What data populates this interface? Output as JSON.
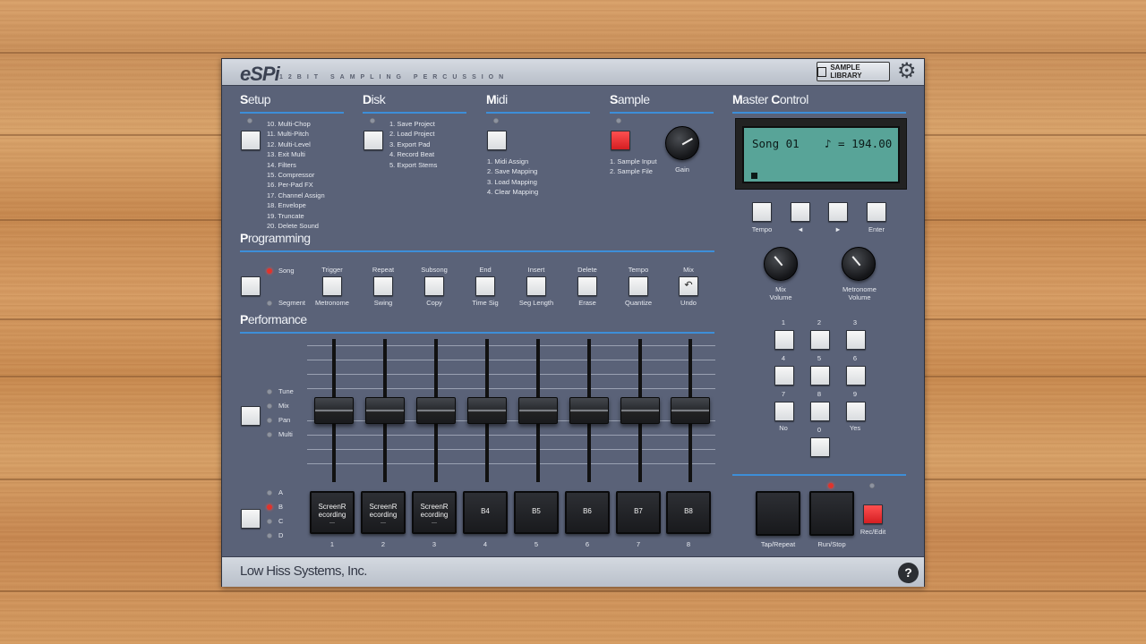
{
  "app": {
    "logo": "eSPi",
    "subtitle": "12BIT SAMPLING PERCUSSION",
    "sample_library": "SAMPLE LIBRARY",
    "footer_brand": "Low Hiss Systems, Inc.",
    "help": "?"
  },
  "setup": {
    "title_first": "S",
    "title_rest": "etup",
    "items": [
      "10. Multi-Chop",
      "11. Multi-Pitch",
      "12. Multi-Level",
      "13. Exit Multi",
      "14. Filters",
      "15. Compressor",
      "16. Per-Pad FX",
      "17. Channel Assign",
      "18. Envelope",
      "19. Truncate",
      "20. Delete Sound"
    ]
  },
  "disk": {
    "title_first": "D",
    "title_rest": "isk",
    "items": [
      "1. Save Project",
      "2. Load Project",
      "3. Export Pad",
      "4. Record Beat",
      "5. Export Stems"
    ]
  },
  "midi": {
    "title_first": "M",
    "title_rest": "idi",
    "items": [
      "1. Midi Assign",
      "2. Save Mapping",
      "3. Load Mapping",
      "4. Clear Mapping"
    ]
  },
  "sample": {
    "title_first": "S",
    "title_rest": "ample",
    "items": [
      "1. Sample Input",
      "2. Sample File"
    ],
    "gain": "Gain"
  },
  "master": {
    "title_first": "M",
    "title_rest": "aster ",
    "title_first2": "C",
    "title_rest2": "ontrol",
    "lcd_line_left": "Song 01",
    "lcd_line_right": "♪ = 194.00",
    "nav": [
      "Tempo",
      "◄",
      "►",
      "Enter"
    ],
    "mix_volume": "Mix\nVolume",
    "metronome_volume": "Metronome\nVolume",
    "keypad": [
      "1",
      "2",
      "3",
      "4",
      "5",
      "6",
      "7",
      "8",
      "9",
      "No",
      "0",
      "Yes"
    ],
    "transport": [
      "Tap/Repeat",
      "Run/Stop",
      "Rec/Edit"
    ]
  },
  "programming": {
    "title_first": "P",
    "title_rest": "rogramming",
    "song": "Song",
    "segment": "Segment",
    "top_labels": [
      "Trigger",
      "Repeat",
      "Subsong",
      "End",
      "Insert",
      "Delete",
      "Tempo",
      "Mix"
    ],
    "bottom_labels": [
      "Metronome",
      "Swing",
      "Copy",
      "Time Sig",
      "Seg Length",
      "Erase",
      "Quantize",
      "Undo"
    ]
  },
  "performance": {
    "title_first": "P",
    "title_rest": "erformance",
    "modes": [
      "Tune",
      "Mix",
      "Pan",
      "Multi"
    ],
    "banks": [
      "A",
      "B",
      "C",
      "D"
    ],
    "pads": [
      {
        "label": "ScreenR\necording",
        "dash": "—",
        "num": "1"
      },
      {
        "label": "ScreenR\necording",
        "dash": "—",
        "num": "2"
      },
      {
        "label": "ScreenR\necording",
        "dash": "—",
        "num": "3"
      },
      {
        "label": "B4",
        "dash": "",
        "num": "4"
      },
      {
        "label": "B5",
        "dash": "",
        "num": "5"
      },
      {
        "label": "B6",
        "dash": "",
        "num": "6"
      },
      {
        "label": "B7",
        "dash": "",
        "num": "7"
      },
      {
        "label": "B8",
        "dash": "",
        "num": "8"
      }
    ]
  }
}
